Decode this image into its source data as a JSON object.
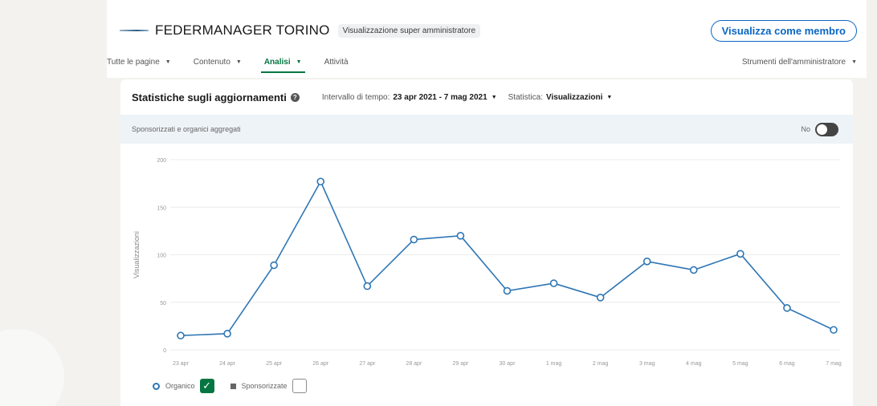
{
  "header": {
    "company_name": "FEDERMANAGER TORINO",
    "admin_badge": "Visualizzazione super amministratore",
    "member_button": "Visualizza come membro"
  },
  "nav": {
    "items": [
      {
        "label": "Tutte le pagine"
      },
      {
        "label": "Contenuto"
      },
      {
        "label": "Analisi",
        "active": true
      },
      {
        "label": "Attività"
      }
    ],
    "admin_tools": "Strumenti dell'amministratore"
  },
  "stats": {
    "title": "Statistiche sugli aggiornamenti",
    "interval_label": "Intervallo di tempo:",
    "interval_value": "23 apr 2021 - 7 mag 2021",
    "metric_label": "Statistica:",
    "metric_value": "Visualizzazioni",
    "aggregate_label": "Sponsorizzati e organici aggregati",
    "toggle_label": "No"
  },
  "legend": {
    "organic": "Organico",
    "sponsored": "Sponsorizzate"
  },
  "colors": {
    "accent": "#0a66c2",
    "active_tab": "#057642",
    "line": "#2f76b5"
  },
  "chart_data": {
    "type": "line",
    "ylabel": "Visualizzazioni",
    "xlabel": "",
    "ylim": [
      0,
      200
    ],
    "yticks": [
      0,
      50,
      100,
      150,
      200
    ],
    "grid": true,
    "legend_position": "bottom-left",
    "categories": [
      "23 apr",
      "24 apr",
      "25 apr",
      "26 apr",
      "27 apr",
      "28 apr",
      "29 apr",
      "30 apr",
      "1 mag",
      "2 mag",
      "3 mag",
      "4 mag",
      "5 mag",
      "6 mag",
      "7 mag"
    ],
    "series": [
      {
        "name": "Organico",
        "values": [
          15,
          17,
          89,
          177,
          67,
          116,
          120,
          62,
          70,
          55,
          93,
          84,
          101,
          44,
          21
        ]
      }
    ]
  }
}
